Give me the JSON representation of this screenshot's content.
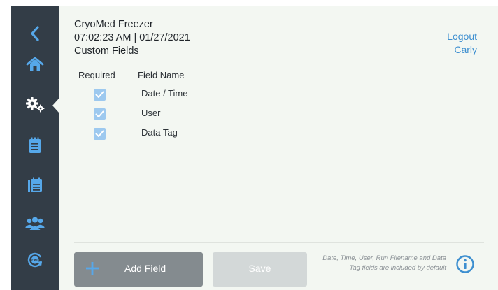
{
  "header": {
    "app_title": "CryoMed Freezer",
    "datetime": "07:02:23 AM | 01/27/2021",
    "page_title": "Custom Fields"
  },
  "user": {
    "logout_label": "Logout",
    "username": "Carly"
  },
  "table": {
    "columns": [
      "Required",
      "Field Name"
    ],
    "rows": [
      {
        "required": true,
        "field_name": "Date / Time"
      },
      {
        "required": true,
        "field_name": "User"
      },
      {
        "required": true,
        "field_name": "Data Tag"
      }
    ]
  },
  "footer": {
    "add_label": "Add Field",
    "save_label": "Save",
    "note": "Date, Time, User, Run Filename and Data Tag fields are included by default"
  },
  "sidebar": {
    "items": [
      "back-icon",
      "home-icon",
      "settings-icon",
      "clipboard-icon",
      "list-calendar-icon",
      "users-icon",
      "calibration-icon"
    ],
    "active": "settings-icon"
  },
  "colors": {
    "sidebar_bg": "#333d47",
    "accent_blue": "#3d8fd0",
    "content_bg": "#f3f7f2",
    "checkbox": "#9dc9ef"
  }
}
